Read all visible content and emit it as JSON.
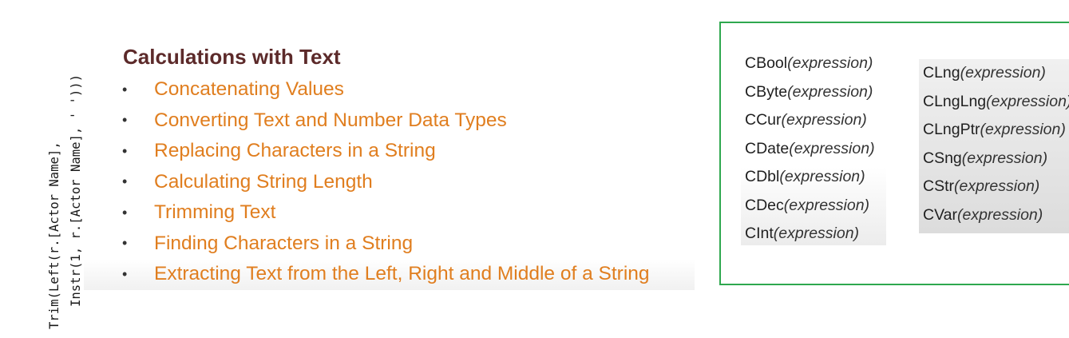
{
  "code": {
    "line1": "Trim(Left(r.[Actor Name],",
    "line2": "Instr(1, r.[Actor Name], ' ')))"
  },
  "slide": {
    "title": "Calculations with Text",
    "bullet_glyph": "•",
    "bullets": [
      "Concatenating Values",
      "Converting Text and Number Data Types",
      "Replacing Characters in a String",
      "Calculating String Length",
      "Trimming Text",
      "Finding Characters in a String",
      "Extracting Text from the Left, Right and Middle of a String"
    ]
  },
  "functions": {
    "left_column": [
      {
        "name": "CBool",
        "arg": "(expression)"
      },
      {
        "name": "CByte",
        "arg": "(expression)"
      },
      {
        "name": "CCur",
        "arg": "(expression)"
      },
      {
        "name": "CDate",
        "arg": "(expression)"
      },
      {
        "name": "CDbl",
        "arg": "(expression)"
      },
      {
        "name": "CDec",
        "arg": "(expression)"
      },
      {
        "name": "CInt",
        "arg": "(expression)"
      }
    ],
    "right_column": [
      {
        "name": "CLng",
        "arg": "(expression)"
      },
      {
        "name": "CLngLng",
        "arg": "(expression)"
      },
      {
        "name": "CLngPtr",
        "arg": "(expression)"
      },
      {
        "name": "CSng",
        "arg": "(expression)"
      },
      {
        "name": "CStr",
        "arg": "(expression)"
      },
      {
        "name": "CVar",
        "arg": "(expression)"
      }
    ]
  },
  "colors": {
    "title": "#5c2a2a",
    "bullet_text": "#e07e1f",
    "box_border": "#2fa84f"
  }
}
